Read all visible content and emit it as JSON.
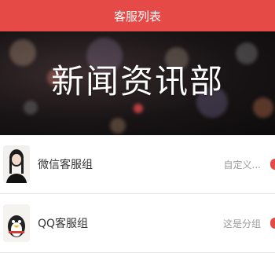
{
  "header": {
    "title": "客服列表"
  },
  "banner": {
    "title": "新闻资讯部"
  },
  "groups": [
    {
      "name": "微信客服组",
      "meta": "自定义...",
      "avatar_icon": "person-avatar-icon"
    },
    {
      "name": "QQ客服组",
      "meta": "这是分组",
      "avatar_icon": "qq-penguin-avatar-icon"
    }
  ],
  "colors": {
    "accent": "#e64a47",
    "banner_bg": "#181415"
  }
}
